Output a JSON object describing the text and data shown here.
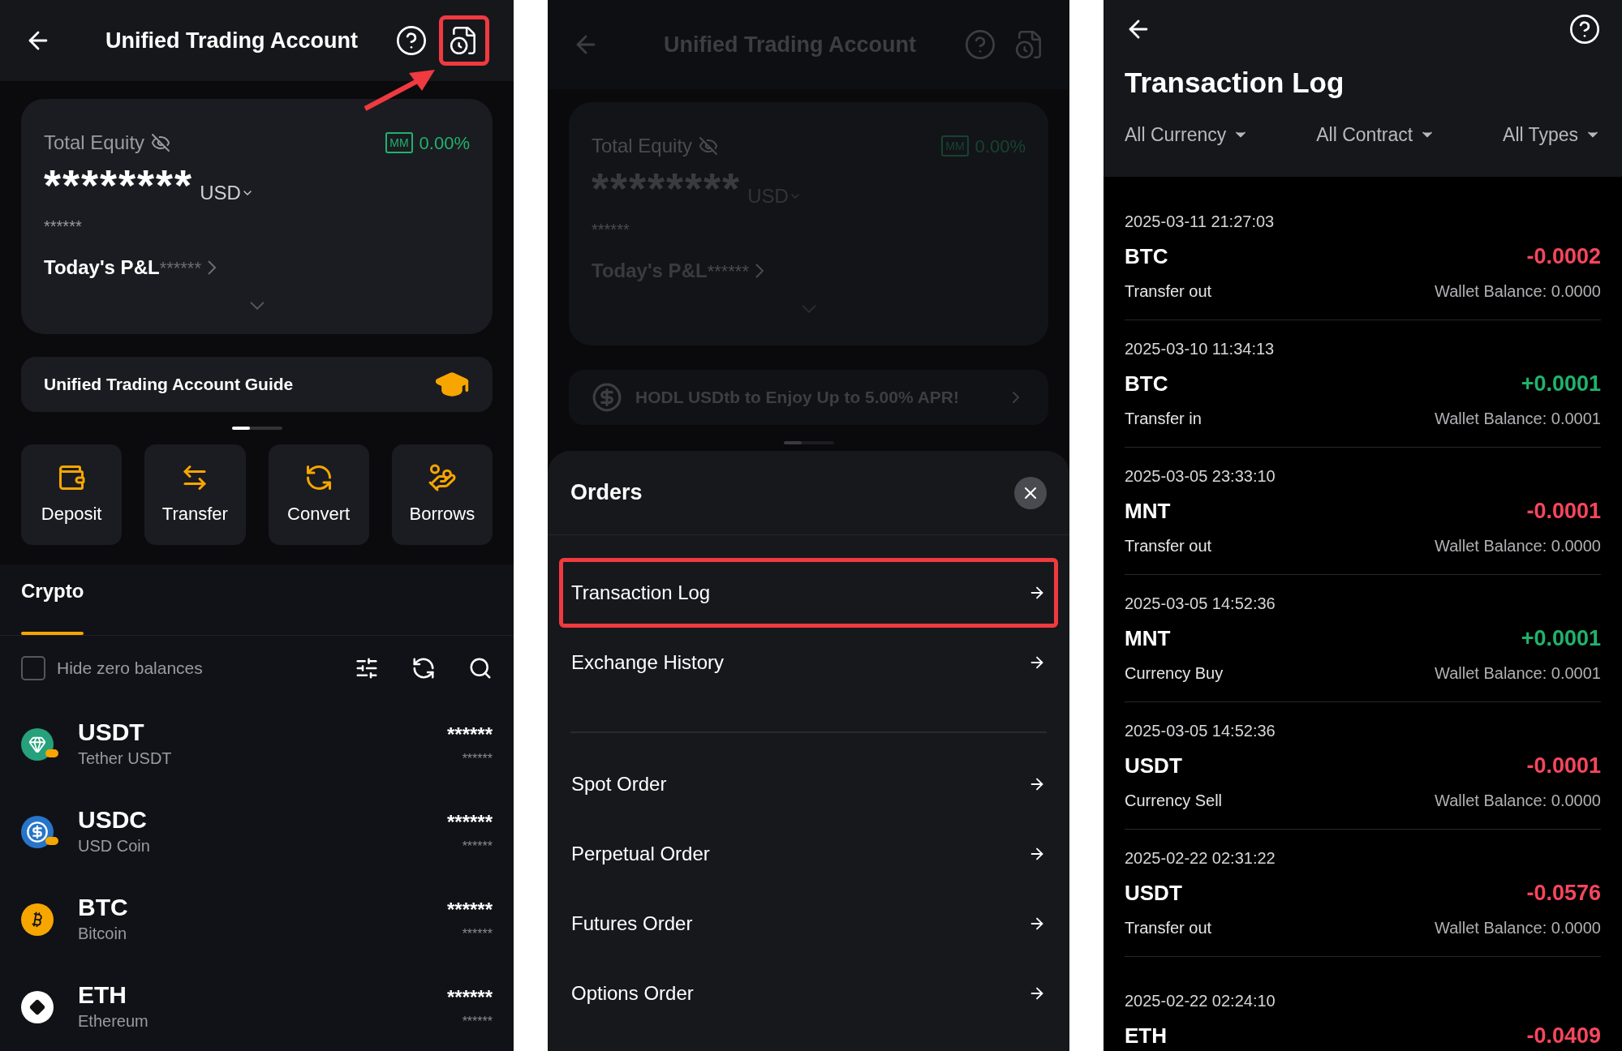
{
  "account_screen": {
    "header": {
      "title": "Unified Trading Account",
      "log_icon_highlighted": true
    },
    "equity_card": {
      "label": "Total Equity",
      "mm_badge": "MM",
      "mm_rate": "0.00%",
      "balance": "********",
      "currency": "USD",
      "sub_balance": "******",
      "pnl_label": "Today's P&L",
      "pnl_value": "******"
    },
    "banner": {
      "text": "Unified Trading Account Guide"
    },
    "actions": [
      "Deposit",
      "Transfer",
      "Convert",
      "Borrows"
    ],
    "tabs": [
      {
        "label": "Crypto",
        "selected": true
      }
    ],
    "hide_zero": {
      "label": "Hide zero balances",
      "checked": false
    },
    "assets": [
      {
        "symbol": "USDT",
        "name": "Tether USDT",
        "kind": "tether",
        "amount": "******",
        "value": "******"
      },
      {
        "symbol": "USDC",
        "name": "USD Coin",
        "kind": "usdc",
        "amount": "******",
        "value": "******"
      },
      {
        "symbol": "BTC",
        "name": "Bitcoin",
        "kind": "bitcoin",
        "amount": "******",
        "value": "******"
      },
      {
        "symbol": "ETH",
        "name": "Ethereum",
        "kind": "ether",
        "amount": "******",
        "value": "******"
      }
    ]
  },
  "orders_screen": {
    "background": {
      "title": "Unified Trading Account",
      "equity_card": {
        "label": "Total Equity",
        "mm_badge": "MM",
        "mm_rate": "0.00%",
        "balance": "********",
        "currency": "USD",
        "sub_balance": "******",
        "pnl_label": "Today's P&L",
        "pnl_value": "******"
      },
      "banner": {
        "text": "HODL USDtb to Enjoy Up to 5.00% APR!"
      }
    },
    "sheet": {
      "title": "Orders",
      "groups": [
        [
          {
            "label": "Transaction Log",
            "highlighted": true
          },
          {
            "label": "Exchange History",
            "highlighted": false
          }
        ],
        [
          {
            "label": "Spot Order",
            "highlighted": false
          },
          {
            "label": "Perpetual Order",
            "highlighted": false
          },
          {
            "label": "Futures Order",
            "highlighted": false
          },
          {
            "label": "Options Order",
            "highlighted": false
          }
        ]
      ]
    }
  },
  "transaction_log_screen": {
    "title": "Transaction Log",
    "filters": [
      "All Currency",
      "All Contract",
      "All Types"
    ],
    "entries": [
      {
        "time": "2025-03-11 21:27:03",
        "coin": "BTC",
        "amount": "-0.0002",
        "color": "#f6465d",
        "type": "Transfer out",
        "balance": "Wallet Balance: 0.0000"
      },
      {
        "time": "2025-03-10 11:34:13",
        "coin": "BTC",
        "amount": "+0.0001",
        "color": "#20b26c",
        "type": "Transfer in",
        "balance": "Wallet Balance: 0.0001"
      },
      {
        "time": "2025-03-05 23:33:10",
        "coin": "MNT",
        "amount": "-0.0001",
        "color": "#f6465d",
        "type": "Transfer out",
        "balance": "Wallet Balance: 0.0000"
      },
      {
        "time": "2025-03-05 14:52:36",
        "coin": "MNT",
        "amount": "+0.0001",
        "color": "#20b26c",
        "type": "Currency Buy",
        "balance": "Wallet Balance: 0.0001"
      },
      {
        "time": "2025-03-05 14:52:36",
        "coin": "USDT",
        "amount": "-0.0001",
        "color": "#f6465d",
        "type": "Currency Sell",
        "balance": "Wallet Balance: 0.0000"
      },
      {
        "time": "2025-02-22 02:31:22",
        "coin": "USDT",
        "amount": "-0.0576",
        "color": "#f6465d",
        "type": "Transfer out",
        "balance": "Wallet Balance: 0.0000"
      },
      {
        "time": "2025-02-22 02:24:10",
        "coin": "ETH",
        "amount": "-0.0409",
        "color": "#f6465d"
      }
    ]
  }
}
